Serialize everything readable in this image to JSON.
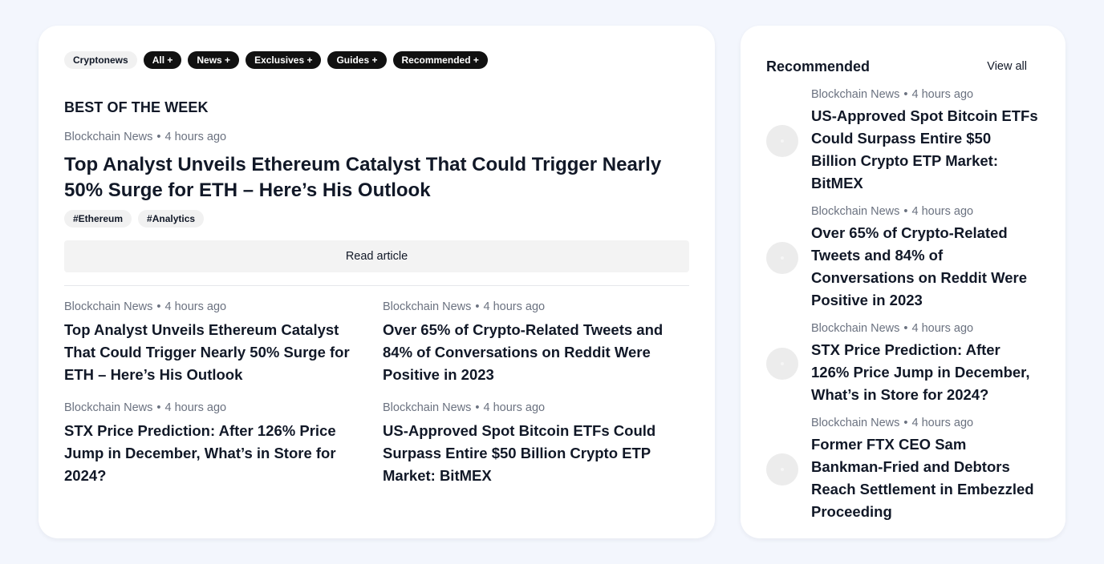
{
  "chips": [
    {
      "label": "Cryptonews",
      "style": "light"
    },
    {
      "label": "All +",
      "style": "dark"
    },
    {
      "label": "News +",
      "style": "dark"
    },
    {
      "label": "Exclusives +",
      "style": "dark"
    },
    {
      "label": "Guides +",
      "style": "dark"
    },
    {
      "label": "Recommended +",
      "style": "dark"
    }
  ],
  "section_title": "BEST OF THE WEEK",
  "featured": {
    "source": "Blockchain News",
    "separator": "•",
    "time": "4 hours ago",
    "headline": "Top Analyst Unveils Ethereum Catalyst That Could Trigger Nearly 50% Surge for ETH – Here’s His Outlook",
    "tags": [
      "#Ethereum",
      "#Analytics"
    ],
    "cta": "Read article"
  },
  "grid_articles": [
    {
      "source": "Blockchain News",
      "separator": "•",
      "time": "4 hours ago",
      "headline": "Top Analyst Unveils Ethereum Catalyst That Could Trigger Nearly 50% Surge for ETH – Here’s His Outlook"
    },
    {
      "source": "Blockchain News",
      "separator": "•",
      "time": "4 hours ago",
      "headline": "Over 65% of Crypto-Related Tweets and 84% of Conversations on Reddit Were Positive in 2023"
    },
    {
      "source": "Blockchain News",
      "separator": "•",
      "time": "4 hours ago",
      "headline": "STX Price Prediction: After 126% Price Jump in December, What’s in Store for 2024?"
    },
    {
      "source": "Blockchain News",
      "separator": "•",
      "time": "4 hours ago",
      "headline": "US-Approved Spot Bitcoin ETFs Could Surpass Entire $50 Billion Crypto ETP Market: BitMEX"
    }
  ],
  "sidebar": {
    "title": "Recommended",
    "view_all": "View all",
    "items": [
      {
        "source": "Blockchain News",
        "separator": "•",
        "time": "4 hours ago",
        "headline": "US-Approved Spot Bitcoin ETFs Could Surpass Entire $50 Billion Crypto ETP Market: BitMEX"
      },
      {
        "source": "Blockchain News",
        "separator": "•",
        "time": "4 hours ago",
        "headline": "Over 65% of Crypto-Related Tweets and 84% of Conversations on Reddit Were Positive in 2023"
      },
      {
        "source": "Blockchain News",
        "separator": "•",
        "time": "4 hours ago",
        "headline": "STX Price Prediction: After 126% Price Jump in December, What’s in Store for 2024?"
      },
      {
        "source": "Blockchain News",
        "separator": "•",
        "time": "4 hours ago",
        "headline": "Former FTX CEO Sam Bankman-Fried and Debtors Reach Settlement in Embezzled Proceeding"
      }
    ]
  },
  "colors": {
    "page_background": "#f3f6fd",
    "card_background": "#ffffff",
    "chip_dark": "#111111",
    "chip_light": "#f1f1f1",
    "meta_text": "#6b7280",
    "headline_text": "#111827"
  }
}
